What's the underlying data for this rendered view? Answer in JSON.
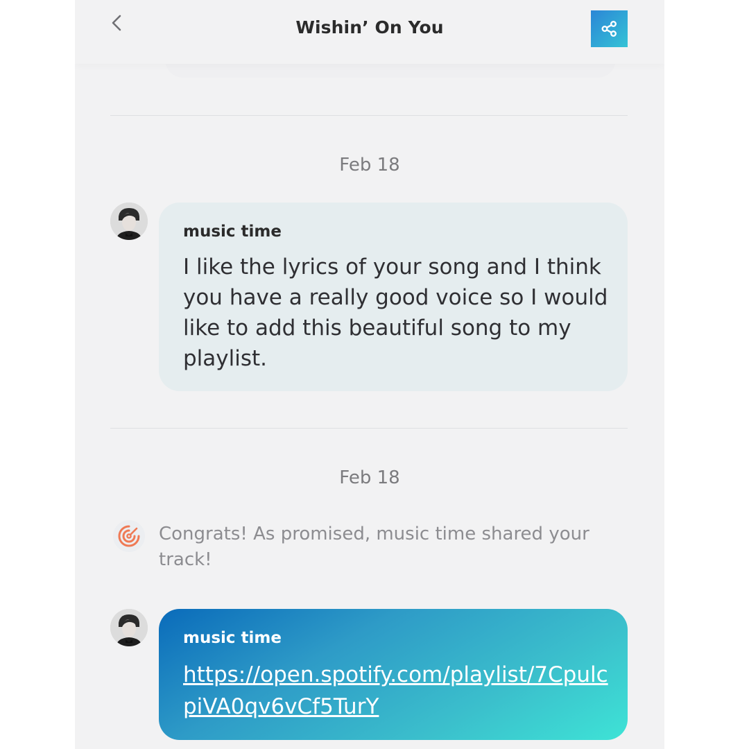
{
  "header": {
    "title": "Wishin’ On You",
    "back_icon": "chevron-left-icon",
    "share_icon": "share-icon"
  },
  "messages": [
    {
      "date": "Feb 18",
      "sender": "music time",
      "text": "I like the lyrics of your song and I think you have a really good voice so I would like to add this beautiful song to my playlist."
    },
    {
      "date": "Feb 18",
      "system_text": "Congrats! As promised, music time shared your track!",
      "system_icon": "target-icon"
    },
    {
      "sender": "music time",
      "link": "https://open.spotify.com/playlist/7CpulcpiVA0qv6vCf5TurY"
    }
  ],
  "colors": {
    "background": "#f2f2f3",
    "bubble_light": "#e5edef",
    "accent_blue": "#0a6bba",
    "accent_teal": "#3ee3d6",
    "system_icon": "#ef7a55"
  }
}
